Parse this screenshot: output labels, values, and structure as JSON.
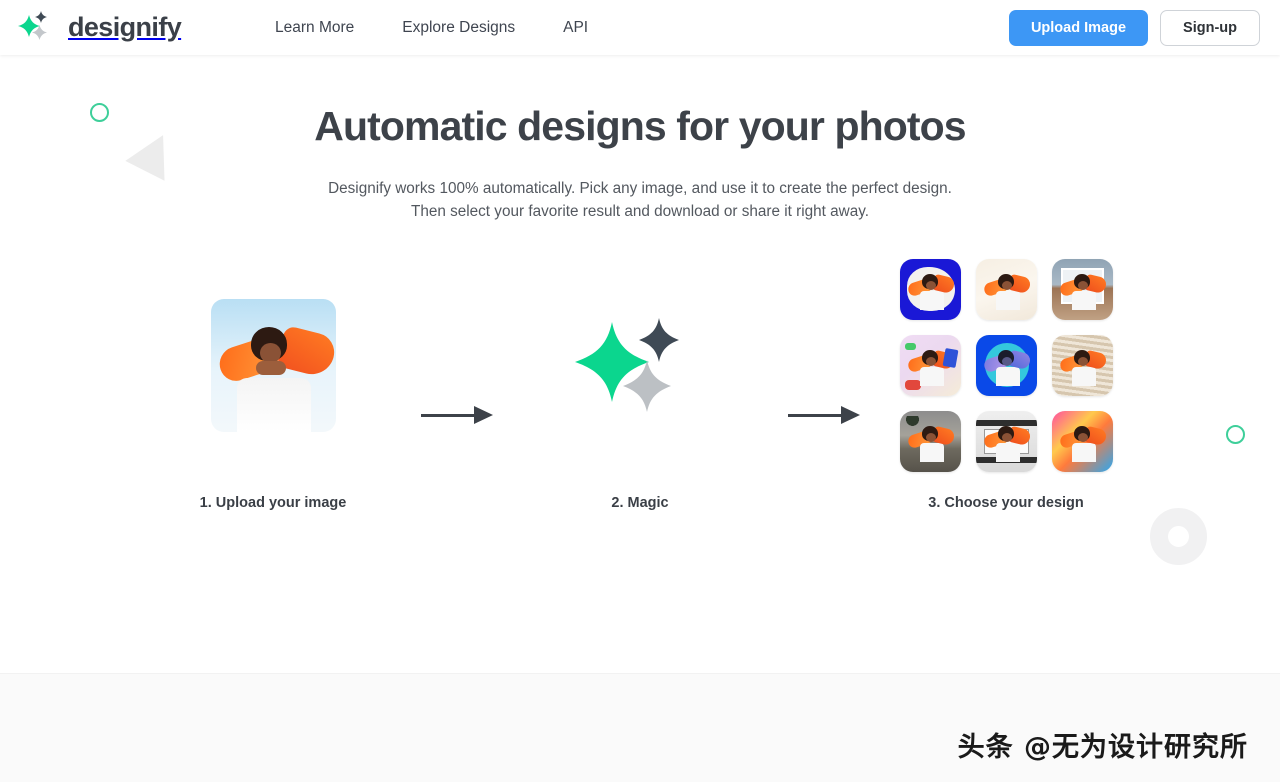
{
  "header": {
    "brand_name": "designify",
    "logo_icon": "sparkle-logo-icon",
    "nav": [
      {
        "label": "Learn More",
        "name": "nav-link-learn-more"
      },
      {
        "label": "Explore Designs",
        "name": "nav-link-explore-designs"
      },
      {
        "label": "API",
        "name": "nav-link-api"
      }
    ],
    "upload_label": "Upload Image",
    "signup_label": "Sign-up",
    "accent_blue": "#3d97f5",
    "brand_green": "#0bd68e"
  },
  "hero": {
    "title": "Automatic designs for your photos",
    "subtitle_line1": "Designify works 100% automatically. Pick any image, and use it to create the perfect design.",
    "subtitle_line2": "Then select your favorite result and download or share it right away."
  },
  "steps": [
    {
      "label": "1. Upload your image",
      "name": "step-upload"
    },
    {
      "label": "2. Magic",
      "name": "step-magic"
    },
    {
      "label": "3. Choose your design",
      "name": "step-choose"
    }
  ],
  "magic": {
    "sparkle_large_color": "#0bd68e",
    "sparkle_dark_color": "#3f4a55",
    "sparkle_gray_color": "#bcc0c4"
  },
  "results": {
    "tiles": [
      {
        "name": "result-tile-blue-cutout",
        "style": "bg-1"
      },
      {
        "name": "result-tile-cream-gradient",
        "style": "bg-2"
      },
      {
        "name": "result-tile-beach-frame",
        "style": "bg-3"
      },
      {
        "name": "result-tile-pastel-stickers",
        "style": "bg-4"
      },
      {
        "name": "result-tile-blue-duotone",
        "style": "bg-5"
      },
      {
        "name": "result-tile-striped-tan",
        "style": "bg-6"
      },
      {
        "name": "result-tile-tropical-dusk",
        "style": "bg-7"
      },
      {
        "name": "result-tile-film-strip",
        "style": "bg-8"
      },
      {
        "name": "result-tile-rainbow-gradient",
        "style": "bg-9"
      }
    ]
  },
  "decorations": {
    "ring_top": "green-ring-icon",
    "triangle": "gray-triangle-icon",
    "ring_right": "green-ring-icon",
    "donut": "gray-donut-icon",
    "arrow": "arrow-right-icon"
  },
  "footer": {
    "watermark": "头条 @无为设计研究所"
  }
}
